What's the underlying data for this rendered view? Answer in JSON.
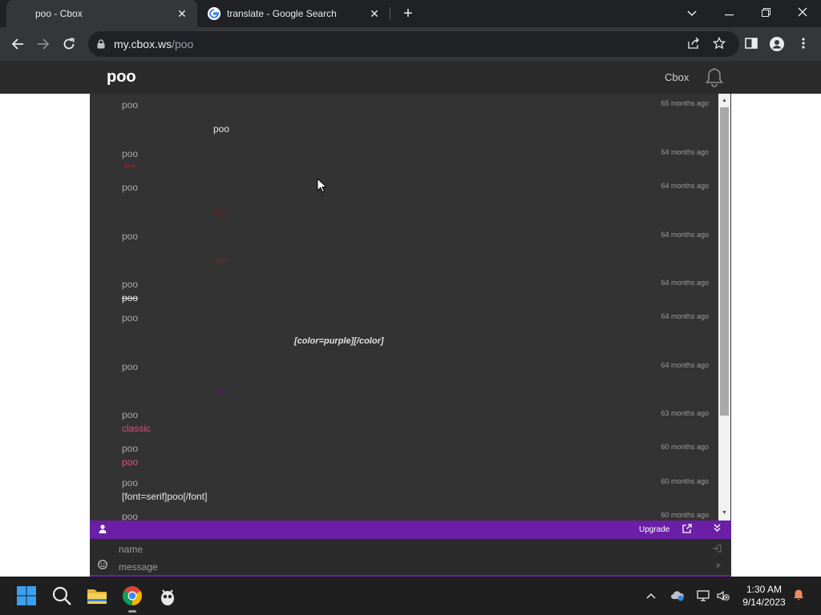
{
  "browser": {
    "tabs": [
      {
        "title": "poo - Cbox",
        "active": true
      },
      {
        "title": "translate - Google Search",
        "active": false
      }
    ],
    "url_host": "my.cbox.ws",
    "url_path": "/poo",
    "new_tab_label": "+",
    "close_glyph": "✕",
    "minimize_glyph": "—",
    "restore_glyph": "❐",
    "tablist_glyph": "⌄"
  },
  "page": {
    "title": "poo",
    "cbox_link": "Cbox"
  },
  "messages": [
    {
      "name": "poo",
      "time": "65 months ago",
      "text": "poo",
      "color": "#e8e8e8",
      "style": "centered"
    },
    {
      "name": "poo",
      "time": "64 months ago",
      "text": "test",
      "color": "#7a2a2a",
      "style": "inline-strike-small"
    },
    {
      "name": "poo",
      "time": "64 months ago",
      "text": "test",
      "color": "#6a2222",
      "style": "centered-small"
    },
    {
      "name": "poo",
      "time": "64 months ago",
      "text": "test",
      "color": "#7a2a2a",
      "style": "centered-italic-small"
    },
    {
      "name": "poo",
      "time": "64 months ago",
      "text": "poo",
      "color": "#e8e8e8",
      "style": "inline-strike"
    },
    {
      "name": "poo",
      "time": "64 months ago",
      "text": "[color=purple][/color]",
      "color": "#e0e0e0",
      "style": "centered-bold-italic"
    },
    {
      "name": "poo",
      "time": "64 months ago",
      "text": "test",
      "color": "#5a1a6a",
      "style": "centered-small"
    },
    {
      "name": "poo",
      "time": "63 months ago",
      "text": "classic",
      "color": "#e0507a",
      "style": "inline"
    },
    {
      "name": "poo",
      "time": "60 months ago",
      "text": "poo",
      "color": "#e0507a",
      "style": "inline"
    },
    {
      "name": "poo",
      "time": "60 months ago",
      "text": "[font=serif]poo[/font]",
      "color": "#e8e8e8",
      "style": "inline"
    },
    {
      "name": "poo",
      "time": "60 months ago",
      "text": "",
      "color": "#e8e8e8",
      "style": "inline"
    }
  ],
  "bar": {
    "upgrade_label": "Upgrade"
  },
  "form": {
    "name_placeholder": "name",
    "message_placeholder": "message"
  },
  "taskbar": {
    "time": "1:30 AM",
    "date": "9/14/2023"
  },
  "colors": {
    "accent_purple": "#6b1fa7",
    "chat_bg": "#333333"
  }
}
